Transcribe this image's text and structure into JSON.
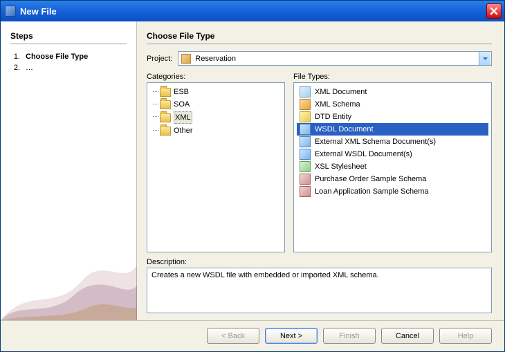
{
  "window": {
    "title": "New File"
  },
  "side": {
    "heading": "Steps",
    "steps": [
      {
        "num": "1.",
        "label": "Choose File Type",
        "current": true
      },
      {
        "num": "2.",
        "label": "…",
        "current": false
      }
    ]
  },
  "main": {
    "heading": "Choose File Type",
    "project_label": "Project:",
    "project_value": "Reservation",
    "categories_label": "Categories:",
    "categories": [
      {
        "label": "ESB",
        "selected": false
      },
      {
        "label": "SOA",
        "selected": false
      },
      {
        "label": "XML",
        "selected": true
      },
      {
        "label": "Other",
        "selected": false
      }
    ],
    "filetypes_label": "File Types:",
    "filetypes": [
      {
        "label": "XML Document",
        "icon": "doc",
        "selected": false
      },
      {
        "label": "XML Schema",
        "icon": "schema",
        "selected": false
      },
      {
        "label": "DTD Entity",
        "icon": "dtd",
        "selected": false
      },
      {
        "label": "WSDL Document",
        "icon": "wsdl",
        "selected": true
      },
      {
        "label": "External XML Schema Document(s)",
        "icon": "wsdl",
        "selected": false
      },
      {
        "label": "External WSDL Document(s)",
        "icon": "wsdl",
        "selected": false
      },
      {
        "label": "XSL Stylesheet",
        "icon": "xsl",
        "selected": false
      },
      {
        "label": "Purchase Order Sample Schema",
        "icon": "order",
        "selected": false
      },
      {
        "label": "Loan Application Sample Schema",
        "icon": "order",
        "selected": false
      }
    ],
    "description_label": "Description:",
    "description_text": "Creates a new WSDL file with embedded or imported XML schema."
  },
  "buttons": {
    "back": "< Back",
    "next": "Next >",
    "finish": "Finish",
    "cancel": "Cancel",
    "help": "Help"
  }
}
